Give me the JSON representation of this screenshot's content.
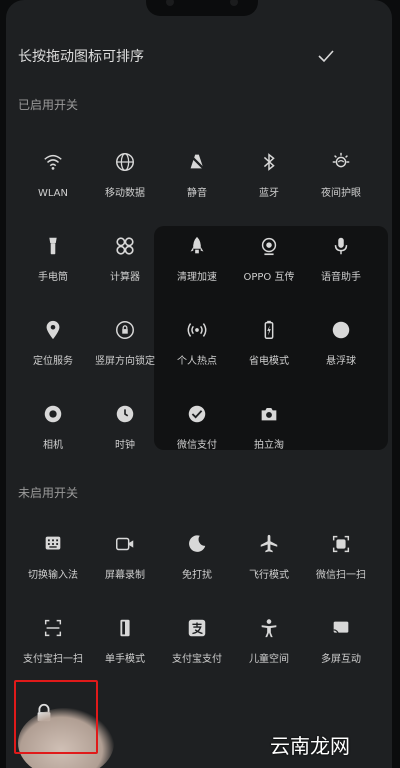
{
  "header": {
    "title": "长按拖动图标可排序"
  },
  "sections": {
    "enabled_label": "已启用开关",
    "disabled_label": "未启用开关"
  },
  "enabled": [
    {
      "label": "WLAN",
      "icon": "wifi-icon"
    },
    {
      "label": "移动数据",
      "icon": "globe-icon"
    },
    {
      "label": "静音",
      "icon": "mute-icon"
    },
    {
      "label": "蓝牙",
      "icon": "bluetooth-icon"
    },
    {
      "label": "夜间护眼",
      "icon": "eye-care-icon"
    },
    {
      "label": "手电筒",
      "icon": "flashlight-icon"
    },
    {
      "label": "计算器",
      "icon": "calculator-icon"
    },
    {
      "label": "清理加速",
      "icon": "rocket-icon"
    },
    {
      "label": "OPPO 互传",
      "icon": "share-icon"
    },
    {
      "label": "语音助手",
      "icon": "microphone-icon"
    },
    {
      "label": "定位服务",
      "icon": "location-icon"
    },
    {
      "label": "竖屏方向锁定",
      "icon": "rotation-lock-icon"
    },
    {
      "label": "个人热点",
      "icon": "hotspot-icon"
    },
    {
      "label": "省电模式",
      "icon": "battery-saver-icon"
    },
    {
      "label": "悬浮球",
      "icon": "floating-ball-icon"
    },
    {
      "label": "相机",
      "icon": "camera-lens-icon"
    },
    {
      "label": "时钟",
      "icon": "clock-icon"
    },
    {
      "label": "微信支付",
      "icon": "wechat-pay-icon"
    },
    {
      "label": "拍立淘",
      "icon": "camera-icon"
    }
  ],
  "disabled": [
    {
      "label": "切换输入法",
      "icon": "keyboard-icon"
    },
    {
      "label": "屏幕录制",
      "icon": "screen-record-icon"
    },
    {
      "label": "免打扰",
      "icon": "moon-icon"
    },
    {
      "label": "飞行模式",
      "icon": "airplane-icon"
    },
    {
      "label": "微信扫一扫",
      "icon": "wechat-scan-icon"
    },
    {
      "label": "支付宝扫一扫",
      "icon": "scan-icon"
    },
    {
      "label": "单手模式",
      "icon": "one-hand-icon"
    },
    {
      "label": "支付宝支付",
      "icon": "alipay-icon"
    },
    {
      "label": "儿童空间",
      "icon": "child-icon"
    },
    {
      "label": "多屏互动",
      "icon": "cast-icon"
    }
  ],
  "highlight_tile": {
    "icon": "lock-icon"
  },
  "watermark": "云南龙网",
  "colors": {
    "background": "#1e2022",
    "highlight": "#e01a1a",
    "icon": "#d8d8d8"
  }
}
